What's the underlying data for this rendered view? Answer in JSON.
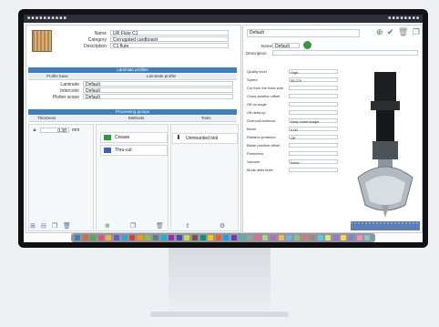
{
  "menubar": {
    "app_title": "■ ■ ■ ■ ■ ■ ■ ■ ■ ■",
    "status": "■ ■ ■ ■ ■ ■ ■ ■"
  },
  "material": {
    "name_label": "Name",
    "name_value": "UR Flute C1",
    "category_label": "Category",
    "category_value": "Corrugated cardboard",
    "description_label": "Description",
    "description_value": "C1 flute"
  },
  "laminate": {
    "section_title": "Laminate profiles",
    "col_profile": "Profile base",
    "col_laminate": "Laminate profile",
    "laminate_label": "Laminate",
    "laminate_value": "Default",
    "intercolor_label": "Intercolor",
    "intercolor_value": "Default",
    "plotter_label": "Plotter scope",
    "plotter_value": "Default"
  },
  "processing": {
    "section_title": "Processing groups",
    "col_thickness": "Thickness",
    "col_methods": "Methods",
    "col_tools": "Tools",
    "thickness_value": "0.38",
    "thickness_unit": "mm",
    "methods": [
      {
        "label": "Crease",
        "color": "#2f9a3f"
      },
      {
        "label": "Thru-cut",
        "color": "#3b5fc4"
      }
    ],
    "tool_label": "Unmounted tool"
  },
  "bottom_toolbar": {
    "icons": [
      "tool-add-icon",
      "tool-copy-icon",
      "duplicate-icon",
      "delete-icon",
      "add-icon",
      "copy-icon",
      "trash-icon",
      "export-icon",
      "settings-icon"
    ]
  },
  "tool_settings": {
    "name_value": "Default",
    "name_label": "Name",
    "name_input_value": "Default",
    "description_label": "Description",
    "props": [
      {
        "label": "Quality level",
        "value": "High"
      },
      {
        "label": "Speed",
        "value": "55,270"
      },
      {
        "label": "Cut from the back side",
        "value": ""
      },
      {
        "label": "Cross-position offset",
        "value": ""
      },
      {
        "label": "Off on angle",
        "value": ""
      },
      {
        "label": "Off delta up",
        "value": ""
      },
      {
        "label": "Overcut/Undercut",
        "value": "Deep knee shape"
      },
      {
        "label": "Bevel",
        "value": "0.00"
      },
      {
        "label": "Rotation protector",
        "value": "Off"
      },
      {
        "label": "Blade position offset",
        "value": ""
      },
      {
        "label": "Protectors",
        "value": ""
      },
      {
        "label": "Vacuum",
        "value": "None"
      },
      {
        "label": "Mode after knife",
        "value": ""
      }
    ]
  },
  "colors": {
    "accent": "#3b7fc4",
    "green": "#2f9a3f",
    "blue": "#3b5fc4"
  }
}
